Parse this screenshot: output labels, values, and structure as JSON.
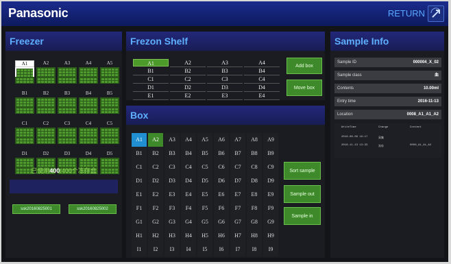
{
  "header": {
    "brand": "Panasonic",
    "return_label": "RETURN"
  },
  "freezer": {
    "title": "Freezer",
    "rows": [
      [
        "A1",
        "A2",
        "A3",
        "A4",
        "A5"
      ],
      [
        "B1",
        "B2",
        "B3",
        "B4",
        "B5"
      ],
      [
        "C1",
        "C2",
        "C3",
        "C4",
        "C5"
      ],
      [
        "D1",
        "D2",
        "D3",
        "D4",
        "D5"
      ]
    ],
    "selected": "A1",
    "usage_prefix": "已使用",
    "usage_used": "400",
    "usage_suffix": "/400个冻存盒",
    "samples": [
      "ssk20160825001",
      "ssk20160825002"
    ]
  },
  "shelf": {
    "title": "Frezon Shelf",
    "rows": [
      [
        "A1",
        "A2",
        "A3",
        "A4"
      ],
      [
        "B1",
        "B2",
        "B3",
        "B4"
      ],
      [
        "C1",
        "C2",
        "C3",
        "C4"
      ],
      [
        "D1",
        "D2",
        "D3",
        "D4"
      ],
      [
        "E1",
        "E2",
        "E3",
        "E4"
      ]
    ],
    "selected": "A1",
    "add_label": "Add box",
    "move_label": "Move box"
  },
  "box": {
    "title": "Box",
    "rows": [
      "A",
      "B",
      "C",
      "D",
      "E",
      "F",
      "G",
      "H",
      "I"
    ],
    "cols": [
      "1",
      "2",
      "3",
      "4",
      "5",
      "6",
      "7",
      "8",
      "9"
    ],
    "highlight_blue": "A1",
    "highlight_green": "A2",
    "sort_label": "Sort sample",
    "out_label": "Sample out",
    "in_label": "Sample in"
  },
  "info": {
    "title": "Sample Info",
    "fields": [
      {
        "key": "Sample ID",
        "value": "000004_X_02"
      },
      {
        "key": "Sample class",
        "value": "血"
      },
      {
        "key": "Contents",
        "value": "10.00ml"
      },
      {
        "key": "Entry time",
        "value": "2016-11-13"
      },
      {
        "key": "Location",
        "value": "0008_A1_A1_A2"
      }
    ],
    "log_headers": [
      "WriteTime",
      "Change",
      "Content"
    ],
    "log_rows": [
      [
        "2016-08-09 19:17",
        "采集",
        ""
      ],
      [
        "2016-11-13 13:33",
        "冻存",
        "0008_A1_A1_A2"
      ]
    ]
  },
  "colors": {
    "accent_blue": "#5eb0ff",
    "green": "#4e9a2e",
    "header_bg": "#1b2b8c"
  }
}
